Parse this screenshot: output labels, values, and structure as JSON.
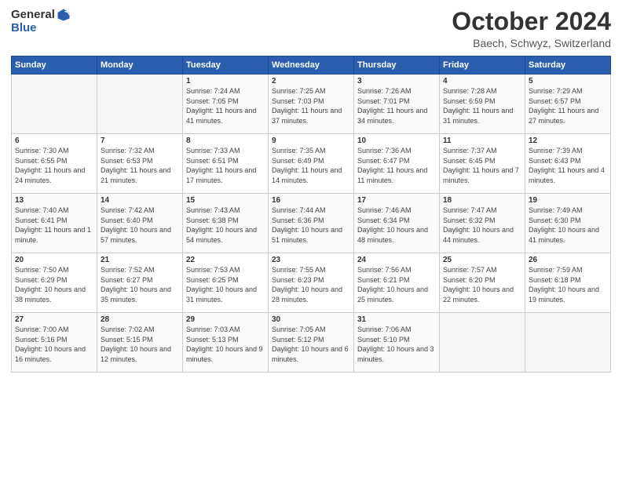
{
  "logo": {
    "general": "General",
    "blue": "Blue"
  },
  "title": "October 2024",
  "subtitle": "Baech, Schwyz, Switzerland",
  "days_header": [
    "Sunday",
    "Monday",
    "Tuesday",
    "Wednesday",
    "Thursday",
    "Friday",
    "Saturday"
  ],
  "weeks": [
    [
      {
        "day": "",
        "empty": true
      },
      {
        "day": "",
        "empty": true
      },
      {
        "day": "1",
        "sunrise": "Sunrise: 7:24 AM",
        "sunset": "Sunset: 7:05 PM",
        "daylight": "Daylight: 11 hours and 41 minutes."
      },
      {
        "day": "2",
        "sunrise": "Sunrise: 7:25 AM",
        "sunset": "Sunset: 7:03 PM",
        "daylight": "Daylight: 11 hours and 37 minutes."
      },
      {
        "day": "3",
        "sunrise": "Sunrise: 7:26 AM",
        "sunset": "Sunset: 7:01 PM",
        "daylight": "Daylight: 11 hours and 34 minutes."
      },
      {
        "day": "4",
        "sunrise": "Sunrise: 7:28 AM",
        "sunset": "Sunset: 6:59 PM",
        "daylight": "Daylight: 11 hours and 31 minutes."
      },
      {
        "day": "5",
        "sunrise": "Sunrise: 7:29 AM",
        "sunset": "Sunset: 6:57 PM",
        "daylight": "Daylight: 11 hours and 27 minutes."
      }
    ],
    [
      {
        "day": "6",
        "sunrise": "Sunrise: 7:30 AM",
        "sunset": "Sunset: 6:55 PM",
        "daylight": "Daylight: 11 hours and 24 minutes."
      },
      {
        "day": "7",
        "sunrise": "Sunrise: 7:32 AM",
        "sunset": "Sunset: 6:53 PM",
        "daylight": "Daylight: 11 hours and 21 minutes."
      },
      {
        "day": "8",
        "sunrise": "Sunrise: 7:33 AM",
        "sunset": "Sunset: 6:51 PM",
        "daylight": "Daylight: 11 hours and 17 minutes."
      },
      {
        "day": "9",
        "sunrise": "Sunrise: 7:35 AM",
        "sunset": "Sunset: 6:49 PM",
        "daylight": "Daylight: 11 hours and 14 minutes."
      },
      {
        "day": "10",
        "sunrise": "Sunrise: 7:36 AM",
        "sunset": "Sunset: 6:47 PM",
        "daylight": "Daylight: 11 hours and 11 minutes."
      },
      {
        "day": "11",
        "sunrise": "Sunrise: 7:37 AM",
        "sunset": "Sunset: 6:45 PM",
        "daylight": "Daylight: 11 hours and 7 minutes."
      },
      {
        "day": "12",
        "sunrise": "Sunrise: 7:39 AM",
        "sunset": "Sunset: 6:43 PM",
        "daylight": "Daylight: 11 hours and 4 minutes."
      }
    ],
    [
      {
        "day": "13",
        "sunrise": "Sunrise: 7:40 AM",
        "sunset": "Sunset: 6:41 PM",
        "daylight": "Daylight: 11 hours and 1 minute."
      },
      {
        "day": "14",
        "sunrise": "Sunrise: 7:42 AM",
        "sunset": "Sunset: 6:40 PM",
        "daylight": "Daylight: 10 hours and 57 minutes."
      },
      {
        "day": "15",
        "sunrise": "Sunrise: 7:43 AM",
        "sunset": "Sunset: 6:38 PM",
        "daylight": "Daylight: 10 hours and 54 minutes."
      },
      {
        "day": "16",
        "sunrise": "Sunrise: 7:44 AM",
        "sunset": "Sunset: 6:36 PM",
        "daylight": "Daylight: 10 hours and 51 minutes."
      },
      {
        "day": "17",
        "sunrise": "Sunrise: 7:46 AM",
        "sunset": "Sunset: 6:34 PM",
        "daylight": "Daylight: 10 hours and 48 minutes."
      },
      {
        "day": "18",
        "sunrise": "Sunrise: 7:47 AM",
        "sunset": "Sunset: 6:32 PM",
        "daylight": "Daylight: 10 hours and 44 minutes."
      },
      {
        "day": "19",
        "sunrise": "Sunrise: 7:49 AM",
        "sunset": "Sunset: 6:30 PM",
        "daylight": "Daylight: 10 hours and 41 minutes."
      }
    ],
    [
      {
        "day": "20",
        "sunrise": "Sunrise: 7:50 AM",
        "sunset": "Sunset: 6:29 PM",
        "daylight": "Daylight: 10 hours and 38 minutes."
      },
      {
        "day": "21",
        "sunrise": "Sunrise: 7:52 AM",
        "sunset": "Sunset: 6:27 PM",
        "daylight": "Daylight: 10 hours and 35 minutes."
      },
      {
        "day": "22",
        "sunrise": "Sunrise: 7:53 AM",
        "sunset": "Sunset: 6:25 PM",
        "daylight": "Daylight: 10 hours and 31 minutes."
      },
      {
        "day": "23",
        "sunrise": "Sunrise: 7:55 AM",
        "sunset": "Sunset: 6:23 PM",
        "daylight": "Daylight: 10 hours and 28 minutes."
      },
      {
        "day": "24",
        "sunrise": "Sunrise: 7:56 AM",
        "sunset": "Sunset: 6:21 PM",
        "daylight": "Daylight: 10 hours and 25 minutes."
      },
      {
        "day": "25",
        "sunrise": "Sunrise: 7:57 AM",
        "sunset": "Sunset: 6:20 PM",
        "daylight": "Daylight: 10 hours and 22 minutes."
      },
      {
        "day": "26",
        "sunrise": "Sunrise: 7:59 AM",
        "sunset": "Sunset: 6:18 PM",
        "daylight": "Daylight: 10 hours and 19 minutes."
      }
    ],
    [
      {
        "day": "27",
        "sunrise": "Sunrise: 7:00 AM",
        "sunset": "Sunset: 5:16 PM",
        "daylight": "Daylight: 10 hours and 16 minutes."
      },
      {
        "day": "28",
        "sunrise": "Sunrise: 7:02 AM",
        "sunset": "Sunset: 5:15 PM",
        "daylight": "Daylight: 10 hours and 12 minutes."
      },
      {
        "day": "29",
        "sunrise": "Sunrise: 7:03 AM",
        "sunset": "Sunset: 5:13 PM",
        "daylight": "Daylight: 10 hours and 9 minutes."
      },
      {
        "day": "30",
        "sunrise": "Sunrise: 7:05 AM",
        "sunset": "Sunset: 5:12 PM",
        "daylight": "Daylight: 10 hours and 6 minutes."
      },
      {
        "day": "31",
        "sunrise": "Sunrise: 7:06 AM",
        "sunset": "Sunset: 5:10 PM",
        "daylight": "Daylight: 10 hours and 3 minutes."
      },
      {
        "day": "",
        "empty": true
      },
      {
        "day": "",
        "empty": true
      }
    ]
  ]
}
